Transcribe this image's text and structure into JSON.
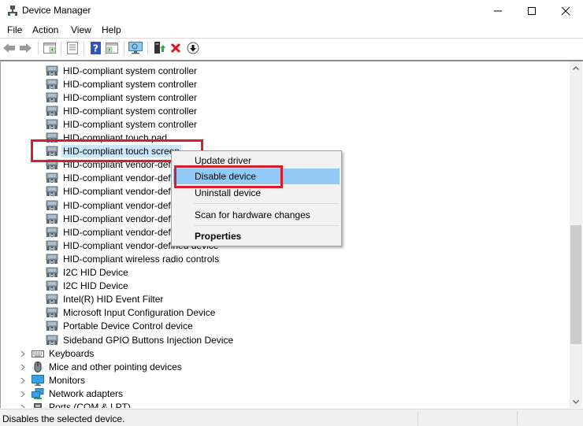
{
  "window": {
    "title": "Device Manager",
    "controls": {
      "minimize": "minimize",
      "maximize": "maximize",
      "close": "close"
    }
  },
  "menubar": {
    "items": [
      "File",
      "Action",
      "View",
      "Help"
    ]
  },
  "toolbar": {
    "buttons": [
      {
        "name": "back",
        "icon": "back-arrow-icon"
      },
      {
        "name": "forward",
        "icon": "forward-arrow-icon"
      },
      {
        "name": "show-hide-console-tree",
        "icon": "console-tree-icon"
      },
      {
        "name": "properties",
        "icon": "properties-sheet-icon"
      },
      {
        "name": "help",
        "icon": "help-icon"
      },
      {
        "name": "show-hide-action-pane",
        "icon": "action-pane-icon"
      },
      {
        "name": "scan-hardware",
        "icon": "monitor-scan-icon"
      },
      {
        "name": "update-driver",
        "icon": "update-driver-icon"
      },
      {
        "name": "uninstall-device",
        "icon": "red-x-icon"
      },
      {
        "name": "disable-device",
        "icon": "down-arrow-circle-icon"
      }
    ]
  },
  "tree": {
    "hid_children": [
      "HID-compliant system controller",
      "HID-compliant system controller",
      "HID-compliant system controller",
      "HID-compliant system controller",
      "HID-compliant system controller",
      "HID-compliant touch pad",
      "HID-compliant touch screen",
      "HID-compliant vendor-defined device",
      "HID-compliant vendor-defined device",
      "HID-compliant vendor-defined device",
      "HID-compliant vendor-defined device",
      "HID-compliant vendor-defined device",
      "HID-compliant vendor-defined device",
      "HID-compliant vendor-defined device",
      "HID-compliant wireless radio controls",
      "I2C HID Device",
      "I2C HID Device",
      "Intel(R) HID Event Filter",
      "Microsoft Input Configuration Device",
      "Portable Device Control device",
      "Sideband GPIO Buttons Injection Device"
    ],
    "selected_index": 6,
    "categories": [
      {
        "label": "Keyboards",
        "icon": "keyboard-icon"
      },
      {
        "label": "Mice and other pointing devices",
        "icon": "mouse-icon"
      },
      {
        "label": "Monitors",
        "icon": "monitor-icon"
      },
      {
        "label": "Network adapters",
        "icon": "network-adapter-icon"
      },
      {
        "label": "Ports (COM & LPT)",
        "icon": "port-icon"
      }
    ]
  },
  "context_menu": {
    "items": [
      {
        "label": "Update driver",
        "active": false,
        "bold": false
      },
      {
        "label": "Disable device",
        "active": true,
        "bold": false
      },
      {
        "label": "Uninstall device",
        "active": false,
        "bold": false
      },
      {
        "label": "Scan for hardware changes",
        "active": false,
        "bold": false
      },
      {
        "label": "Properties",
        "active": false,
        "bold": true
      }
    ]
  },
  "scrollbar": {
    "thumb_start_fraction": 0.47,
    "thumb_size_fraction": 0.37
  },
  "statusbar": {
    "text": "Disables the selected device."
  },
  "colors": {
    "highlight_red": "#d61f2a",
    "menu_active": "#91c9f7",
    "selection": "#cce8ff"
  }
}
